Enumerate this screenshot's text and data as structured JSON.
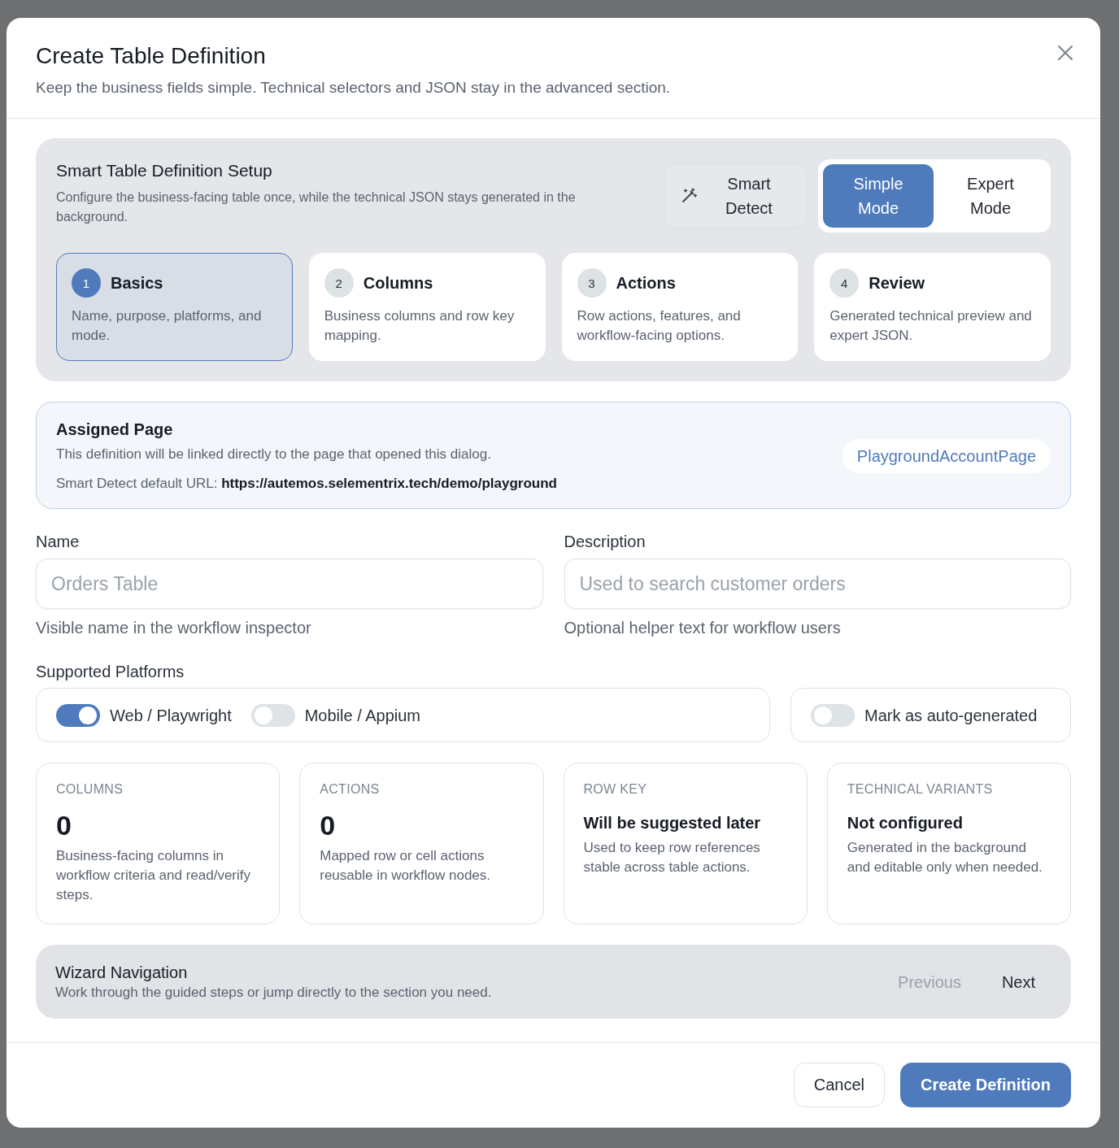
{
  "dialog": {
    "title": "Create Table Definition",
    "subtitle": "Keep the business fields simple. Technical selectors and JSON stay in the advanced section."
  },
  "setup": {
    "title": "Smart Table Definition Setup",
    "description": "Configure the business-facing table once, while the technical JSON stays generated in the background.",
    "smart_detect": {
      "label": "Smart Detect"
    },
    "modes": [
      {
        "label": "Simple Mode",
        "selected": true
      },
      {
        "label": "Expert Mode",
        "selected": false
      }
    ],
    "steps": [
      {
        "number": "1",
        "title": "Basics",
        "description": "Name, purpose, platforms, and mode.",
        "selected": true
      },
      {
        "number": "2",
        "title": "Columns",
        "description": "Business columns and row key mapping.",
        "selected": false
      },
      {
        "number": "3",
        "title": "Actions",
        "description": "Row actions, features, and workflow-facing options.",
        "selected": false
      },
      {
        "number": "4",
        "title": "Review",
        "description": "Generated technical preview and expert JSON.",
        "selected": false
      }
    ]
  },
  "assigned_page": {
    "title": "Assigned Page",
    "description": "This definition will be linked directly to the page that opened this dialog.",
    "url_line": "Smart Detect default URL: **https://autemos.selementrix.tech/demo/playground**",
    "page_badge": "PlaygroundAccountPage"
  },
  "fields": [
    {
      "label": "Name",
      "placeholder": "Orders Table",
      "help": "Visible name in the workflow inspector"
    },
    {
      "label": "Description",
      "placeholder": "Used to search customer orders",
      "help": "Optional helper text for workflow users"
    }
  ],
  "platforms": {
    "label": "Supported Platforms",
    "toggles": [
      {
        "label": "Web / Playwright",
        "on": true
      },
      {
        "label": "Mobile / Appium",
        "on": false
      }
    ],
    "auto_generated": {
      "label": "Mark as auto-generated",
      "on": false
    }
  },
  "stats": [
    {
      "kind": "count",
      "label": "COLUMNS",
      "value": "0",
      "description": "Business-facing columns in workflow criteria and read/verify steps."
    },
    {
      "kind": "count",
      "label": "ACTIONS",
      "value": "0",
      "description": "Mapped row or cell actions reusable in workflow nodes."
    },
    {
      "kind": "status",
      "label": "ROW KEY",
      "value": "Will be suggested later",
      "description": "Used to keep row references stable across table actions."
    },
    {
      "kind": "status",
      "label": "TECHNICAL VARIANTS",
      "value": "Not configured",
      "description": "Generated in the background and editable only when needed."
    }
  ],
  "wizard": {
    "title": "Wizard Navigation",
    "description": "Work through the guided steps or jump directly to the section you need.",
    "buttons": [
      {
        "label": "Previous",
        "disabled": true
      },
      {
        "label": "Next",
        "disabled": false
      }
    ]
  },
  "footer": {
    "buttons": [
      {
        "kind": "secondary",
        "label": "Cancel"
      },
      {
        "kind": "primary",
        "label": "Create Definition"
      }
    ]
  }
}
